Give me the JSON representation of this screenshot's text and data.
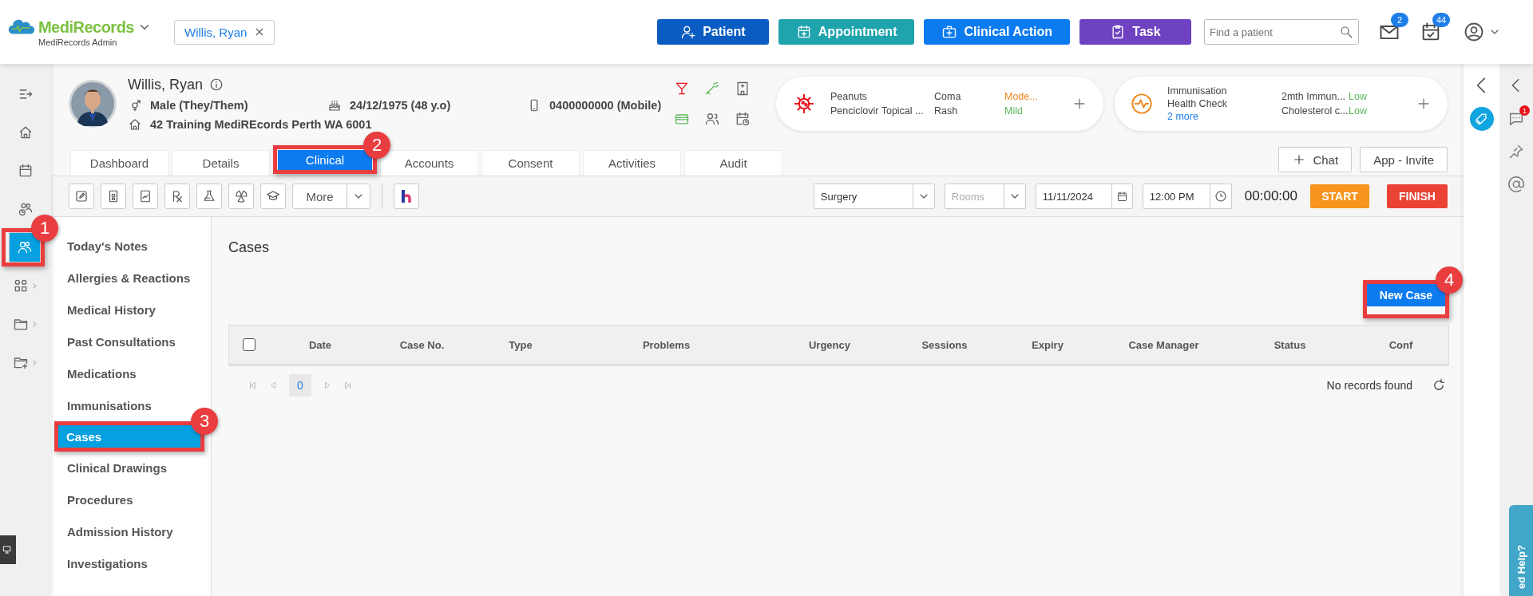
{
  "brand": {
    "name": "MediRecords",
    "subtitle": "MediRecords Admin"
  },
  "open_patient": {
    "name": "Willis, Ryan"
  },
  "actions": [
    {
      "label": "Patient",
      "kind": "patient",
      "color": "#0a5cc2"
    },
    {
      "label": "Appointment",
      "kind": "appointment",
      "color": "#1fa3ad"
    },
    {
      "label": "Clinical Action",
      "kind": "clinical",
      "color": "#0d7bf0"
    },
    {
      "label": "Task",
      "kind": "task",
      "color": "#6f42c1"
    }
  ],
  "search": {
    "placeholder": "Find a patient"
  },
  "notifications": [
    {
      "kind": "mail",
      "count": "2"
    },
    {
      "kind": "calendar",
      "count": "44"
    }
  ],
  "rail": [
    {
      "kind": "collapse",
      "selected": false,
      "submenu": false
    },
    {
      "kind": "home",
      "selected": false,
      "submenu": false
    },
    {
      "kind": "calendar",
      "selected": false,
      "submenu": false
    },
    {
      "kind": "people-clock",
      "selected": false,
      "submenu": false
    },
    {
      "kind": "patients",
      "selected": true,
      "submenu": false,
      "callout": "1"
    },
    {
      "kind": "apps",
      "selected": false,
      "submenu": true
    },
    {
      "kind": "folder",
      "selected": false,
      "submenu": true
    },
    {
      "kind": "folder-plus",
      "selected": false,
      "submenu": true
    }
  ],
  "patient": {
    "name": "Willis, Ryan",
    "gender": "Male (They/Them)",
    "dob": "24/12/1975 (48 y.o)",
    "phone": "0400000000 (Mobile)",
    "address": "42 Training MediREcords Perth WA 6001"
  },
  "allergies": [
    {
      "substance": "Peanuts",
      "reaction": "Coma",
      "severity": "Mode...",
      "color": "#f0861a"
    },
    {
      "substance": "Penciclovir Topical ...",
      "reaction": "Rash",
      "severity": "Mild",
      "color": "#5cb85c"
    }
  ],
  "alerts": {
    "items": [
      "Immunisation",
      "Health Check"
    ],
    "more": "2 more",
    "results": [
      {
        "name": "2mth Immun...",
        "status": "Low",
        "color": "#5cb85c"
      },
      {
        "name": "Cholesterol c...",
        "status": "Low",
        "color": "#5cb85c"
      }
    ]
  },
  "tabs": [
    {
      "label": "Dashboard",
      "selected": false
    },
    {
      "label": "Details",
      "selected": false
    },
    {
      "label": "Clinical",
      "selected": true,
      "callout": "2"
    },
    {
      "label": "Accounts",
      "selected": false
    },
    {
      "label": "Consent",
      "selected": false
    },
    {
      "label": "Activities",
      "selected": false
    },
    {
      "label": "Audit",
      "selected": false
    }
  ],
  "header_buttons": [
    {
      "label": "Chat",
      "kind": "chat"
    },
    {
      "label": "App - Invite",
      "kind": "invite"
    }
  ],
  "toolbar": {
    "more": "More",
    "location": "Surgery",
    "rooms_placeholder": "Rooms",
    "date": "11/11/2024",
    "time": "12:00 PM",
    "timer": "00:00:00",
    "start": "START",
    "finish": "FINISH"
  },
  "menu": [
    {
      "label": "Today's Notes",
      "selected": false
    },
    {
      "label": "Allergies & Reactions",
      "selected": false
    },
    {
      "label": "Medical History",
      "selected": false
    },
    {
      "label": "Past Consultations",
      "selected": false
    },
    {
      "label": "Medications",
      "selected": false
    },
    {
      "label": "Immunisations",
      "selected": false
    },
    {
      "label": "Cases",
      "selected": true,
      "callout": "3"
    },
    {
      "label": "Clinical Drawings",
      "selected": false
    },
    {
      "label": "Procedures",
      "selected": false
    },
    {
      "label": "Admission History",
      "selected": false
    },
    {
      "label": "Investigations",
      "selected": false
    }
  ],
  "content": {
    "title": "Cases",
    "new_button": {
      "label": "New Case",
      "callout": "4"
    },
    "table": {
      "select_all": {
        "checked": false
      },
      "columns": [
        "Date",
        "Case No.",
        "Type",
        "Problems",
        "Urgency",
        "Sessions",
        "Expiry",
        "Case Manager",
        "Status",
        "Conf"
      ]
    },
    "pager": {
      "page": "0"
    },
    "empty_message": "No records found"
  },
  "side": {
    "chat_count": "1",
    "help": "ed Help?"
  }
}
